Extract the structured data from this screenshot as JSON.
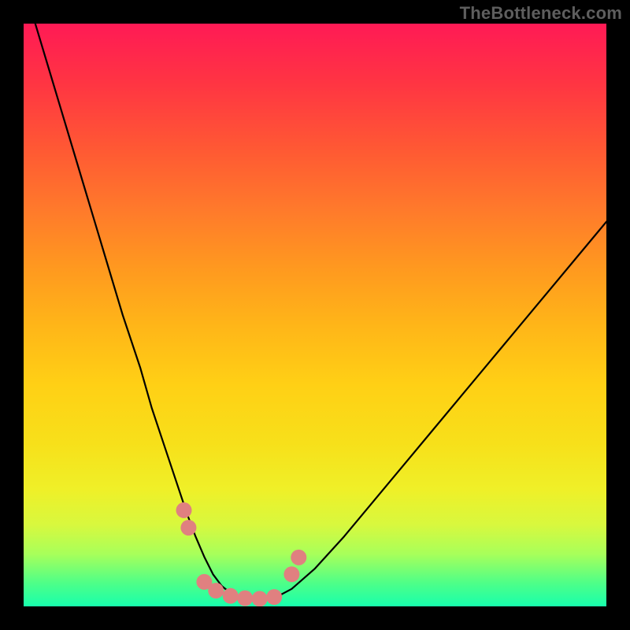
{
  "credit": "TheBottleneck.com",
  "colors": {
    "page_bg": "#000000",
    "gradient_top": "#ff1a55",
    "gradient_bottom": "#18ffac",
    "curve": "#000000",
    "marker_fill": "#e08080",
    "marker_stroke": "#cc6a6a"
  },
  "chart_data": {
    "type": "line",
    "title": "",
    "xlabel": "",
    "ylabel": "",
    "xlim": [
      0,
      100
    ],
    "ylim": [
      0,
      100
    ],
    "grid": false,
    "series": [
      {
        "name": "bottleneck-curve",
        "x": [
          2,
          5,
          8,
          11,
          14,
          17,
          20,
          22,
          24,
          26,
          28,
          29.5,
          31,
          32.5,
          34,
          35.5,
          37,
          40,
          43,
          46,
          50,
          55,
          60,
          65,
          70,
          75,
          80,
          85,
          90,
          95,
          100
        ],
        "y": [
          100,
          90,
          80,
          70,
          60,
          50,
          41,
          34,
          28,
          22,
          16,
          12,
          8.5,
          5.5,
          3.5,
          2.3,
          1.6,
          1.1,
          1.4,
          3,
          6.5,
          12,
          18,
          24,
          30,
          36,
          42,
          48,
          54,
          60,
          66
        ]
      }
    ],
    "markers": [
      {
        "x": 27.5,
        "y": 16.5
      },
      {
        "x": 28.3,
        "y": 13.5
      },
      {
        "x": 31.0,
        "y": 4.2
      },
      {
        "x": 33.0,
        "y": 2.7
      },
      {
        "x": 35.5,
        "y": 1.8
      },
      {
        "x": 38.0,
        "y": 1.4
      },
      {
        "x": 40.5,
        "y": 1.3
      },
      {
        "x": 43.0,
        "y": 1.6
      },
      {
        "x": 46.0,
        "y": 5.5
      },
      {
        "x": 47.2,
        "y": 8.4
      }
    ],
    "marker_radius_px": 10
  }
}
